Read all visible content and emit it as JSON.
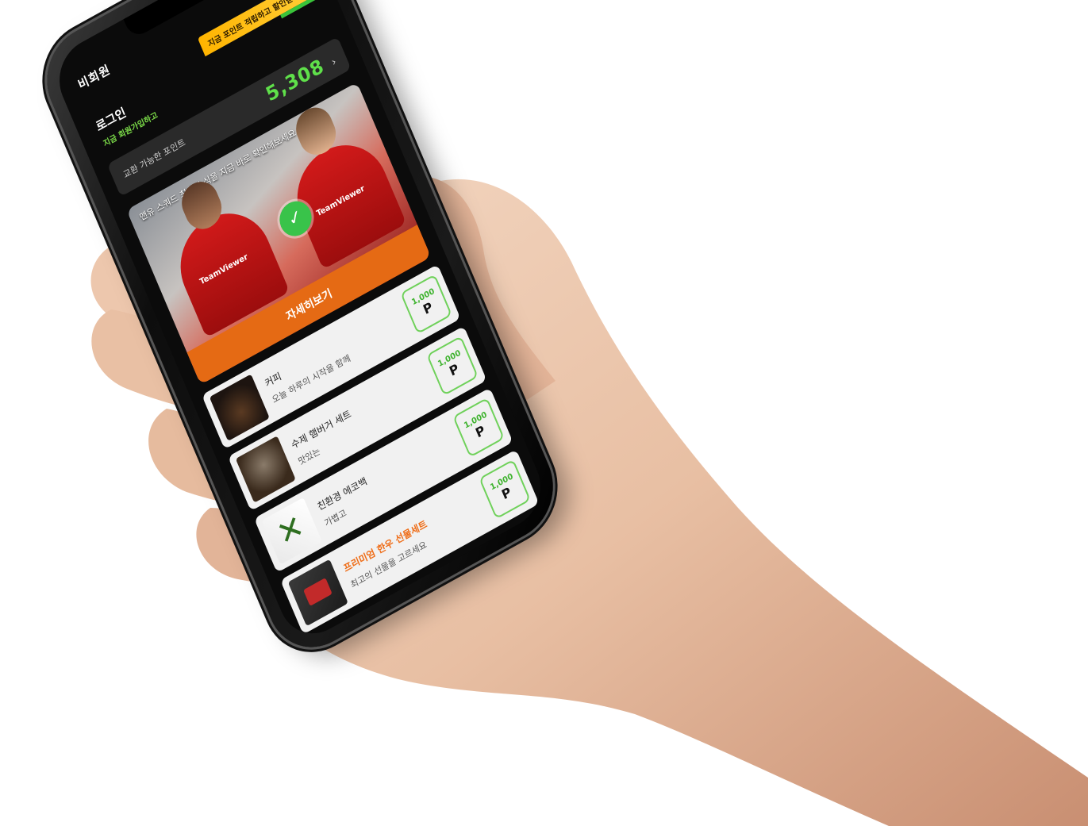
{
  "app": {
    "title": "비회원",
    "promo_badge": "지금 포인트 적립하고 할인받으세요",
    "account": {
      "label": "로그인",
      "sub": "지금 회원가입하고"
    },
    "points": {
      "label": "교환 가능한 포인트",
      "value": "5,308",
      "chevron": "›"
    },
    "banner": {
      "caption": "맨유 스쿼드 최신 소식을 지금 바로 확인해보세요",
      "shirt_text": "TeamViewer",
      "check_symbol": "✓",
      "cta": "자세히보기"
    },
    "products": [
      {
        "name": "커피",
        "desc": "오늘 하루의 시작을 함께",
        "price_top": "1,000",
        "price_icon": "P",
        "highlight": false
      },
      {
        "name": "수제 햄버거 세트",
        "desc": "맛있는",
        "price_top": "1,000",
        "price_icon": "P",
        "highlight": false
      },
      {
        "name": "친환경 에코백",
        "desc": "가볍고",
        "price_top": "1,000",
        "price_icon": "P",
        "highlight": false
      },
      {
        "name": "프리미엄 한우 선물세트",
        "desc": "최고의 선물을 고르세요",
        "price_top": "1,000",
        "price_icon": "P",
        "highlight": true
      }
    ]
  },
  "colors": {
    "accent_green": "#5fe04a",
    "accent_orange": "#e56a14",
    "badge_yellow": "#ffb400",
    "screen_bg": "#0b0b0b"
  }
}
